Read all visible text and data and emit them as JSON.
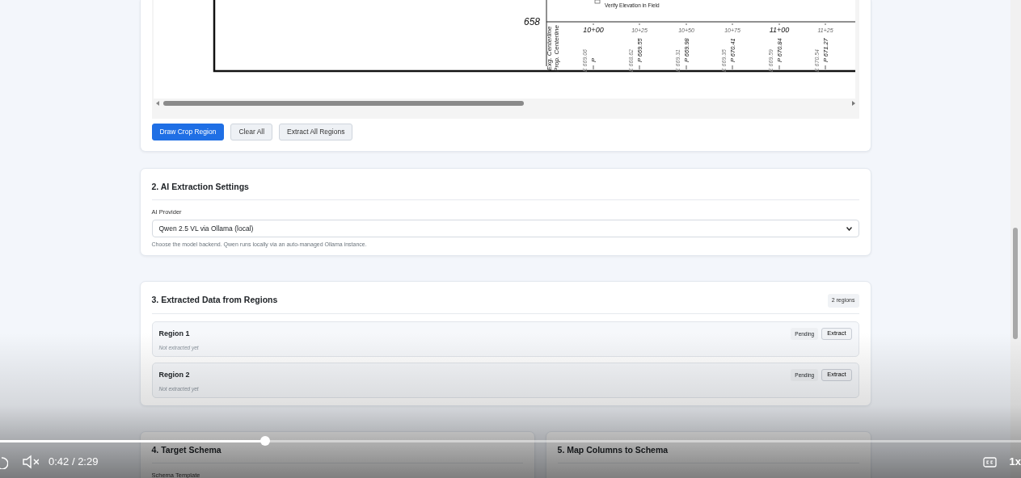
{
  "drawing": {
    "elevation": "658",
    "note": "Verify Elevation in Field",
    "row_labels": [
      "Exg. Centerline",
      "Prop. Centerline"
    ],
    "stations": [
      {
        "label": "10+00",
        "major": true,
        "existing": "E 669.06",
        "proposed": "P"
      },
      {
        "label": "10+25",
        "major": false,
        "existing": "E 668.62",
        "proposed": "P 669.55"
      },
      {
        "label": "10+50",
        "major": false,
        "existing": "E 669.31",
        "proposed": "P 669.98"
      },
      {
        "label": "10+75",
        "major": false,
        "existing": "E 669.35",
        "proposed": "P 670.41"
      },
      {
        "label": "11+00",
        "major": true,
        "existing": "E 669.59",
        "proposed": "P 670.84"
      },
      {
        "label": "11+25",
        "major": false,
        "existing": "E 670.54",
        "proposed": "P 671.27"
      }
    ]
  },
  "crop_buttons": [
    {
      "label": "Draw Crop Region",
      "kind": "primary"
    },
    {
      "label": "Clear All",
      "kind": "secondary"
    },
    {
      "label": "Extract All Regions",
      "kind": "secondary"
    }
  ],
  "settings": {
    "title": "2. AI Extraction Settings",
    "field_label": "AI Provider",
    "value": "Qwen 2.5 VL via Ollama (local)",
    "help": "Choose the model backend. Qwen runs locally via an auto-managed Ollama instance."
  },
  "extracted": {
    "title": "3. Extracted Data from Regions",
    "count": "2 regions",
    "regions": [
      {
        "name": "Region 1",
        "status": "Pending",
        "action": "Extract",
        "detail": "Not extracted yet"
      },
      {
        "name": "Region 2",
        "status": "Pending",
        "action": "Extract",
        "detail": "Not extracted yet"
      }
    ]
  },
  "schema": {
    "title": "4. Target Schema",
    "field_label": "Schema Template"
  },
  "mapping": {
    "title": "5. Map Columns to Schema"
  },
  "video": {
    "time": "0:42 / 2:29",
    "level": 0.26,
    "muted": true,
    "speed": "1x"
  }
}
